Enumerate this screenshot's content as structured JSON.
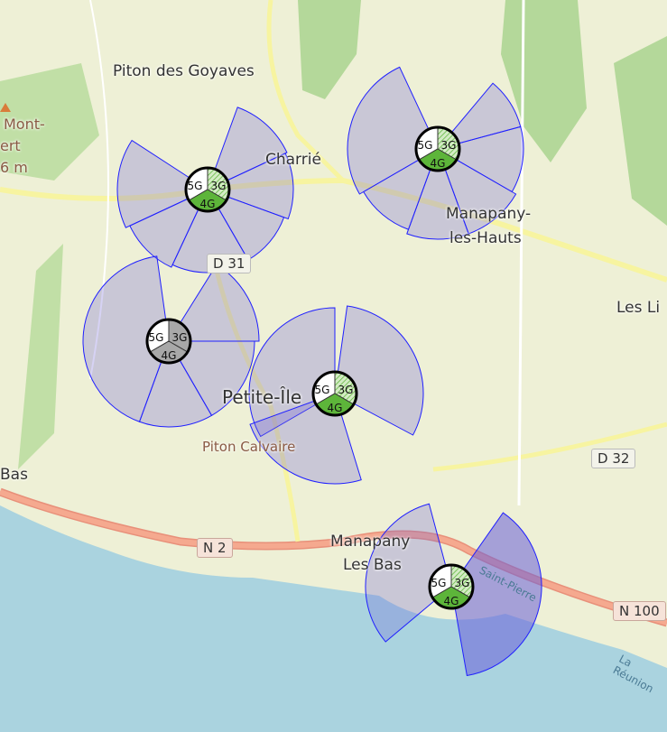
{
  "map": {
    "places": [
      {
        "id": "piton-des-goyaves",
        "label": "Piton des Goyaves"
      },
      {
        "id": "charrie",
        "label": "Charrié"
      },
      {
        "id": "manapany-hauts-1",
        "label": "Manapany-"
      },
      {
        "id": "manapany-hauts-2",
        "label": "les-Hauts"
      },
      {
        "id": "les-li",
        "label": "Les Li"
      },
      {
        "id": "petite-ile",
        "label": "Petite-Île"
      },
      {
        "id": "manapany-bas-1",
        "label": "Manapany"
      },
      {
        "id": "manapany-bas-2",
        "label": "Les Bas"
      },
      {
        "id": "bas",
        "label": "Bas"
      }
    ],
    "peaks": [
      {
        "id": "mont",
        "label": "Mont-"
      },
      {
        "id": "ert",
        "label": "ert"
      },
      {
        "id": "elev",
        "label": "6 m"
      },
      {
        "id": "piton-calvaire",
        "label": "Piton Calvaire"
      }
    ],
    "roads": [
      "D 31",
      "D 32",
      "N 2",
      "N 100"
    ],
    "coast_labels": [
      "Saint-Pierre",
      "La Réunion"
    ],
    "colors": {
      "sector_fill": "#6a5fd8",
      "sector_stroke": "#2020ff",
      "tech_on": "#5db53a",
      "tech_off": "#a8a8a8",
      "sea": "#aad3df"
    }
  },
  "sites": [
    {
      "name": "site-1",
      "techs": [
        {
          "label": "5G",
          "state": "white"
        },
        {
          "label": "3G",
          "state": "hatched"
        },
        {
          "label": "4G",
          "state": "green"
        }
      ]
    },
    {
      "name": "site-2",
      "techs": [
        {
          "label": "5G",
          "state": "white"
        },
        {
          "label": "3G",
          "state": "hatched"
        },
        {
          "label": "4G",
          "state": "green"
        }
      ]
    },
    {
      "name": "site-3",
      "techs": [
        {
          "label": "5G",
          "state": "white"
        },
        {
          "label": "3G",
          "state": "grey"
        },
        {
          "label": "4G",
          "state": "grey"
        }
      ]
    },
    {
      "name": "site-4",
      "techs": [
        {
          "label": "5G",
          "state": "white"
        },
        {
          "label": "3G",
          "state": "hatched"
        },
        {
          "label": "4G",
          "state": "green"
        }
      ]
    },
    {
      "name": "site-5",
      "techs": [
        {
          "label": "5G",
          "state": "white"
        },
        {
          "label": "3G",
          "state": "hatched"
        },
        {
          "label": "4G",
          "state": "green"
        }
      ]
    }
  ]
}
